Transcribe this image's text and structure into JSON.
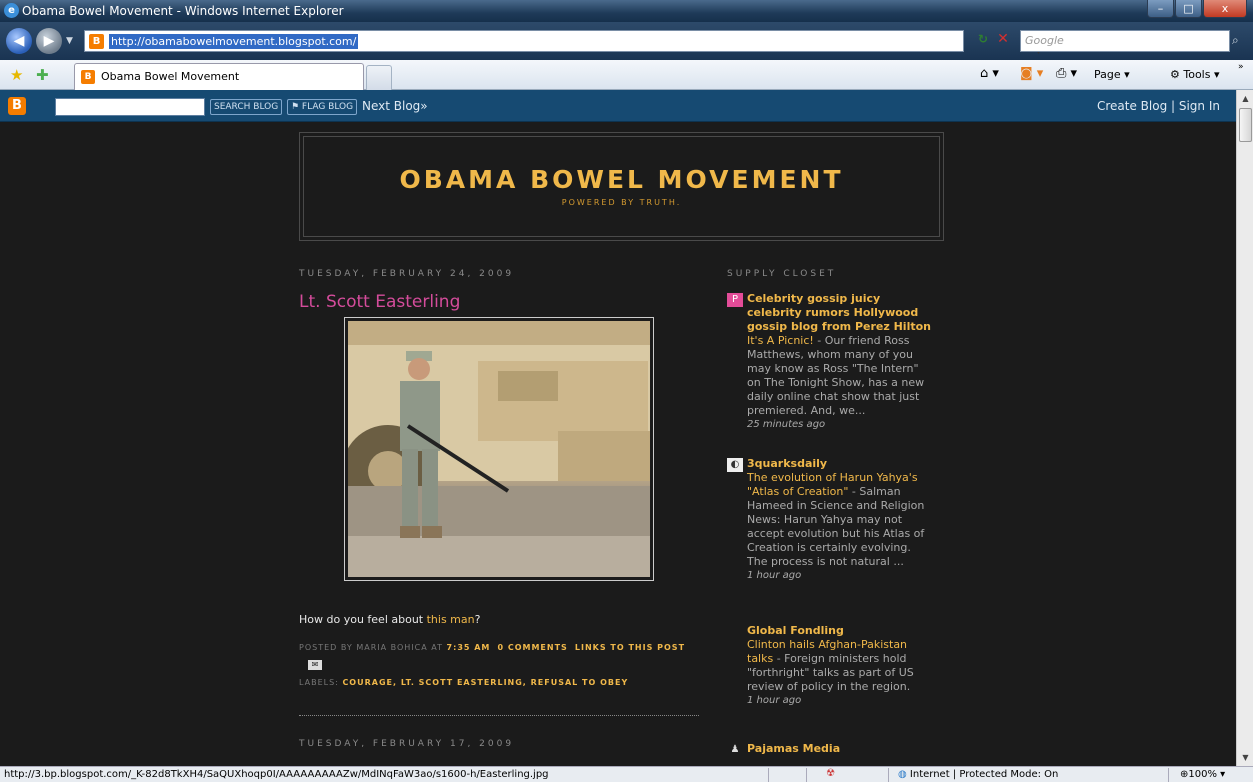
{
  "window": {
    "title": "Obama Bowel Movement - Windows Internet Explorer",
    "minimize": "–",
    "maximize": "□",
    "close": "x"
  },
  "address_bar": {
    "url": "http://obamabowelmovement.blogspot.com/",
    "search_placeholder": "Google"
  },
  "tabs": [
    {
      "label": "Obama Bowel Movement"
    }
  ],
  "commands": {
    "page": "Page ▾",
    "tools": "Tools ▾"
  },
  "navbar": {
    "search_button": "SEARCH BLOG",
    "flag_button": "⚑ FLAG BLOG",
    "next_blog": "Next Blog»",
    "right_links": "Create Blog | Sign In"
  },
  "blog": {
    "title": "OBAMA BOWEL MOVEMENT",
    "tagline": "POWERED BY TRUTH."
  },
  "posts": [
    {
      "date": "TUESDAY, FEBRUARY 24, 2009",
      "title": "Lt. Scott Easterling",
      "body_prefix": "How do you feel about ",
      "body_link": "this man",
      "body_suffix": "?",
      "posted_by_prefix": "POSTED BY MARIA BOHICA AT ",
      "time": "7:35 AM",
      "comments": "0 COMMENTS",
      "links": "LINKS TO THIS POST",
      "labels_prefix": "LABELS: ",
      "labels": "COURAGE, LT. SCOTT EASTERLING, REFUSAL TO OBEY"
    },
    {
      "date": "TUESDAY, FEBRUARY 17, 2009"
    }
  ],
  "sidebar": {
    "title": "SUPPLY CLOSET",
    "feeds": [
      {
        "icon": "perez-icon",
        "name": "Celebrity gossip juicy celebrity rumors Hollywood gossip blog from Perez Hilton",
        "item_link": "It's A Picnic!",
        "item_text": " - Our friend Ross Matthews, whom many of you may know as Ross \"The Intern\" on The Tonight Show, has a new daily online chat show that just premiered. And, we...",
        "time": "25 minutes ago"
      },
      {
        "icon": "quarks-icon",
        "name": "3quarksdaily",
        "item_link": "The evolution of Harun Yahya's \"Atlas of Creation\"",
        "item_text": " - Salman Hameed in Science and Religion News: Harun Yahya may not accept evolution but his Atlas of Creation is certainly evolving. The process is not natural ...",
        "time": "1 hour ago"
      },
      {
        "icon": "",
        "name": "Global Fondling",
        "item_link": "Clinton hails Afghan-Pakistan talks",
        "item_text": " - Foreign ministers hold \"forthright\" talks as part of US review of policy in the region.",
        "time": "1 hour ago"
      },
      {
        "icon": "pajamas-icon",
        "name": "Pajamas Media",
        "item_link": "",
        "item_text": "",
        "time": ""
      }
    ]
  },
  "status_bar": {
    "url": "http://3.bp.blogspot.com/_K-82d8TkXH4/SaQUXhoqp0I/AAAAAAAAAZw/MdINqFaW3ao/s1600-h/Easterling.jpg",
    "zone": "Internet | Protected Mode: On",
    "zoom": "100%"
  }
}
